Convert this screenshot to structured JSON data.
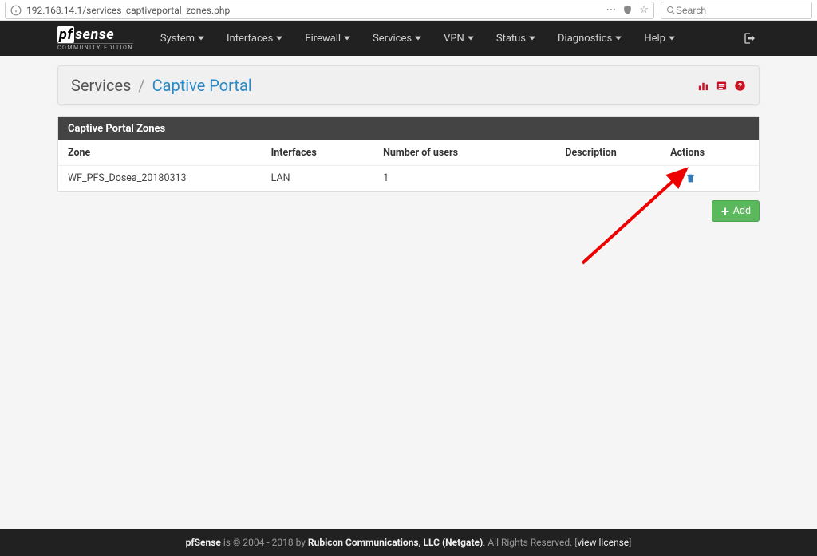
{
  "browser": {
    "url": "192.168.14.1/services_captiveportal_zones.php",
    "search_placeholder": "Search"
  },
  "logo": {
    "pf": "pf",
    "sense": "sense",
    "subtitle": "COMMUNITY EDITION"
  },
  "nav": {
    "items": [
      {
        "label": "System"
      },
      {
        "label": "Interfaces"
      },
      {
        "label": "Firewall"
      },
      {
        "label": "Services"
      },
      {
        "label": "VPN"
      },
      {
        "label": "Status"
      },
      {
        "label": "Diagnostics"
      },
      {
        "label": "Help"
      }
    ]
  },
  "breadcrumb": {
    "part1": "Services",
    "separator": "/",
    "part2": "Captive Portal"
  },
  "panel": {
    "title": "Captive Portal Zones",
    "columns": {
      "zone": "Zone",
      "interfaces": "Interfaces",
      "users": "Number of users",
      "description": "Description",
      "actions": "Actions"
    },
    "rows": [
      {
        "zone": "WF_PFS_Dosea_20180313",
        "interfaces": "LAN",
        "users": "1",
        "description": ""
      }
    ]
  },
  "buttons": {
    "add": "Add"
  },
  "footer": {
    "prefix": "pfSense",
    "mid": " is © 2004 - 2018 by ",
    "company": "Rubicon Communications, LLC (Netgate)",
    "suffix": ". All Rights Reserved. [",
    "link": "view license",
    "close": "]"
  }
}
